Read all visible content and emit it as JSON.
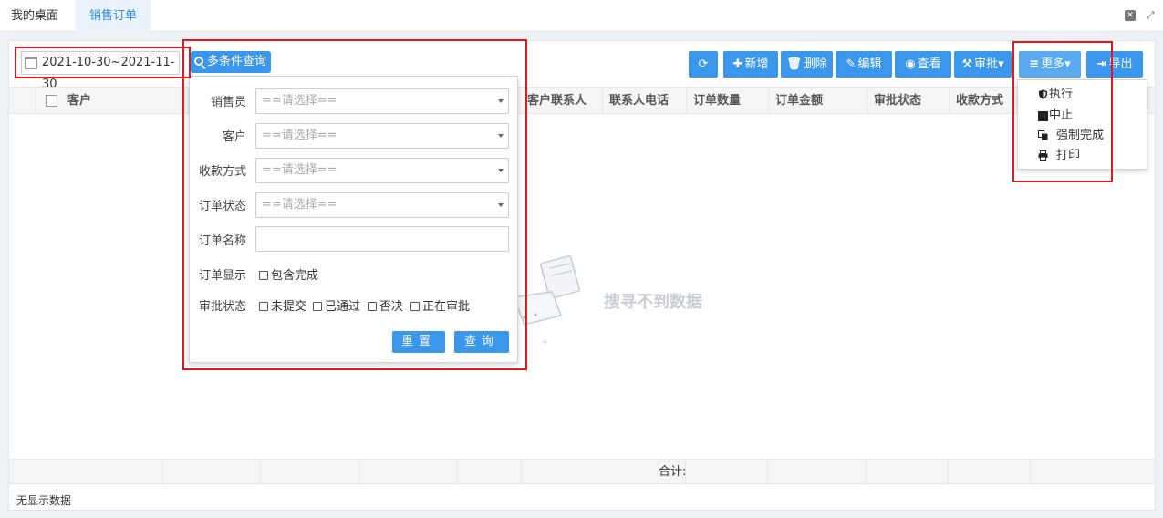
{
  "tabs": {
    "home": "我的桌面",
    "active": "销售订单"
  },
  "date_range": "2021-10-30~2021-11-30",
  "query_button": "多条件查询",
  "toolbar": {
    "new": "新增",
    "delete": "删除",
    "edit": "编辑",
    "view": "查看",
    "approve": "审批",
    "more": "更多",
    "export": "导出"
  },
  "grid": {
    "columns": [
      "客户",
      "客户联系人",
      "联系人电话",
      "订单数量",
      "订单金额",
      "审批状态",
      "收款方式"
    ],
    "empty_text": "搜寻不到数据",
    "total_label": "合计:",
    "status": "无显示数据"
  },
  "search_form": {
    "salesperson_label": "销售员",
    "customer_label": "客户",
    "payment_label": "收款方式",
    "order_status_label": "订单状态",
    "order_name_label": "订单名称",
    "order_display_label": "订单显示",
    "approval_status_label": "审批状态",
    "select_placeholder": "==请选择==",
    "include_complete": "包含完成",
    "approval_options": [
      "未提交",
      "已通过",
      "否决",
      "正在审批"
    ],
    "reset_button": "重置",
    "submit_button": "查询"
  },
  "more_menu": {
    "items": [
      {
        "label": "执行",
        "icon": "shield-icon"
      },
      {
        "label": "中止",
        "icon": "stop-icon"
      },
      {
        "label": "强制完成",
        "icon": "copy-icon"
      },
      {
        "label": "打印",
        "icon": "print-icon"
      }
    ]
  },
  "colors": {
    "primary": "#3b97eb",
    "annotation": "#e5161e"
  }
}
